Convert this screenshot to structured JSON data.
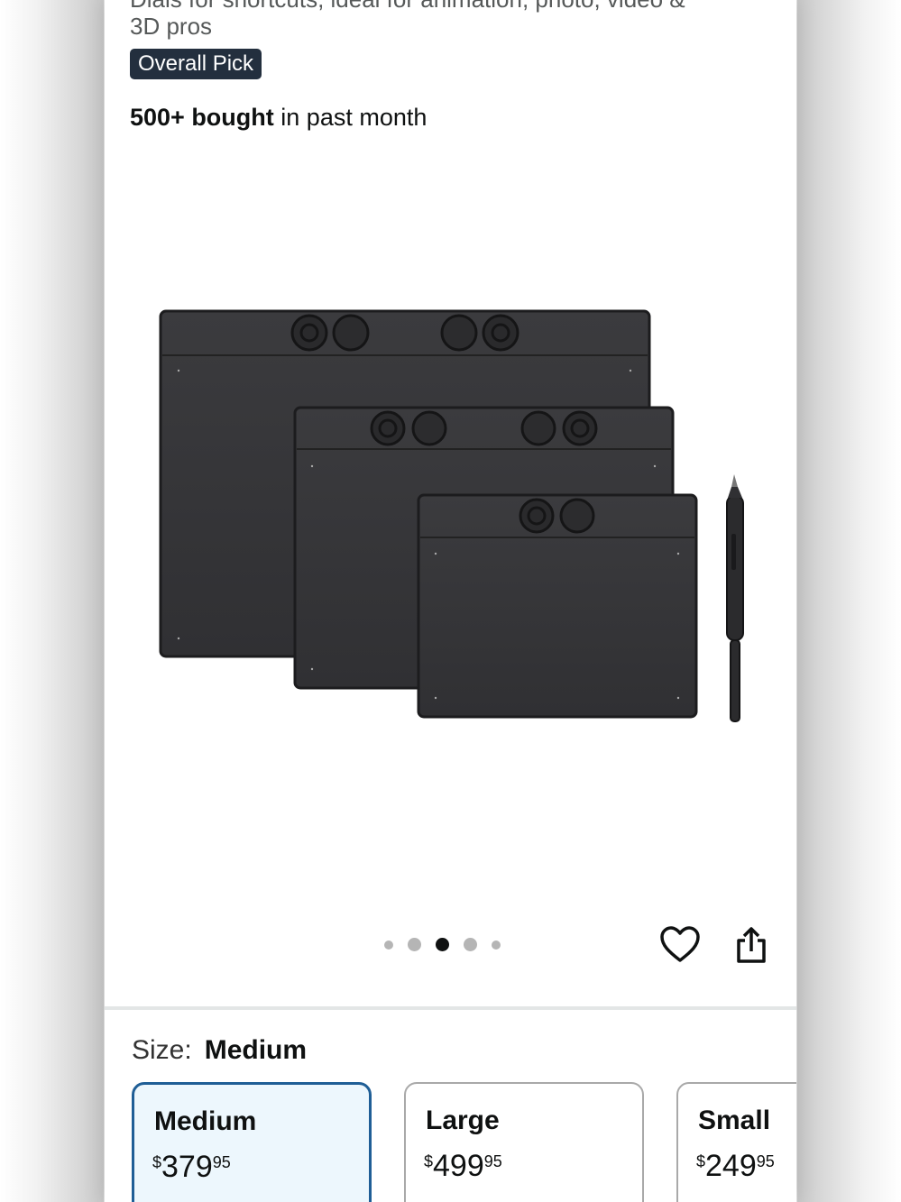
{
  "product": {
    "subtitle_line1": "Dials for shortcuts, ideal for animation, photo, video &",
    "subtitle_line2": "3D pros",
    "badge": "Overall Pick",
    "bought_bold": "500+ bought",
    "bought_rest": " in past month"
  },
  "gallery": {
    "image_icon": "drawing-tablets-image",
    "dot_count": 5,
    "active_index": 2
  },
  "actions": {
    "favorite_icon": "heart-icon",
    "share_icon": "share-icon"
  },
  "size": {
    "label": "Size:",
    "selected": "Medium",
    "options": [
      {
        "name": "Medium",
        "currency": "$",
        "whole": "379",
        "fraction": "95"
      },
      {
        "name": "Large",
        "currency": "$",
        "whole": "499",
        "fraction": "95"
      },
      {
        "name": "Small",
        "currency": "$",
        "whole": "249",
        "fraction": "95"
      }
    ]
  },
  "colors": {
    "badge": "#232f3e",
    "selected_border": "#1f5e96",
    "selected_bg": "#edf7fd"
  }
}
